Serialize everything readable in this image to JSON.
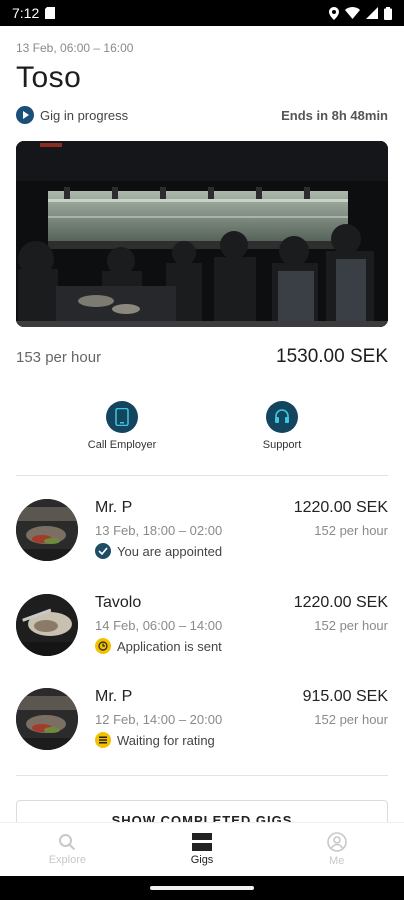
{
  "status_bar": {
    "time": "7:12"
  },
  "current_gig": {
    "date_range": "13 Feb, 06:00 – 16:00",
    "title": "Toso",
    "status": "Gig in progress",
    "ends_in": "Ends in 8h 48min",
    "hourly_rate": "153 per hour",
    "total": "1530.00 SEK"
  },
  "actions": [
    {
      "label": "Call Employer",
      "icon": "phone-icon"
    },
    {
      "label": "Support",
      "icon": "headset-icon"
    }
  ],
  "gigs": [
    {
      "name": "Mr. P",
      "date": "13 Feb, 18:00 – 02:00",
      "status": "You are appointed",
      "status_icon": "check-circle-icon",
      "status_color": "#1f4d66",
      "price": "1220.00 SEK",
      "hourly": "152 per hour"
    },
    {
      "name": "Tavolo",
      "date": "14 Feb, 06:00 – 14:00",
      "status": "Application is sent",
      "status_icon": "clock-icon",
      "status_color": "#f2c200",
      "price": "1220.00 SEK",
      "hourly": "152 per hour"
    },
    {
      "name": "Mr. P",
      "date": "12 Feb, 14:00 – 20:00",
      "status": "Waiting for rating",
      "status_icon": "list-icon",
      "status_color": "#f2c200",
      "price": "915.00 SEK",
      "hourly": "152 per hour"
    }
  ],
  "show_completed_label": "SHOW COMPLETED GIGS",
  "nav": [
    {
      "label": "Explore",
      "icon": "search-icon",
      "active": false
    },
    {
      "label": "Gigs",
      "icon": "gigs-icon",
      "active": true
    },
    {
      "label": "Me",
      "icon": "profile-icon",
      "active": false
    }
  ],
  "colors": {
    "accent": "#14455f",
    "pending": "#f2c200"
  }
}
